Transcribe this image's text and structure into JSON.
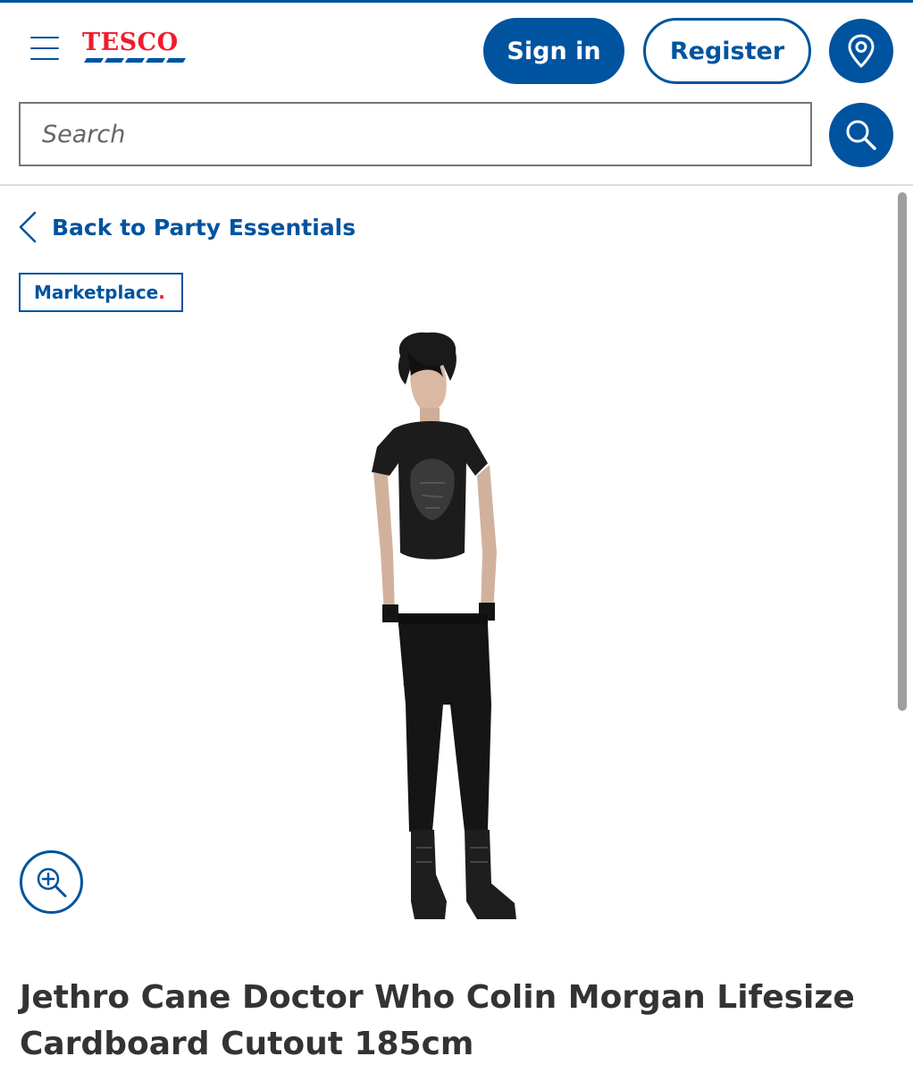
{
  "header": {
    "logo_text": "TESCO",
    "signin_label": "Sign in",
    "register_label": "Register",
    "menu_icon": "hamburger-menu-icon",
    "location_icon": "map-pin-icon"
  },
  "search": {
    "placeholder": "Search",
    "value": "",
    "icon": "search-icon"
  },
  "breadcrumb": {
    "back_label": "Back to Party Essentials",
    "icon": "chevron-left-icon"
  },
  "badge": {
    "label": "Marketplace",
    "dot": "."
  },
  "product": {
    "title": "Jethro Cane Doctor Who Colin Morgan Lifesize Cardboard Cutout 185cm",
    "zoom_icon": "zoom-in-icon"
  },
  "colors": {
    "brand_blue": "#00539f",
    "brand_red": "#ee1c2e",
    "text": "#333333",
    "border": "#757575"
  }
}
